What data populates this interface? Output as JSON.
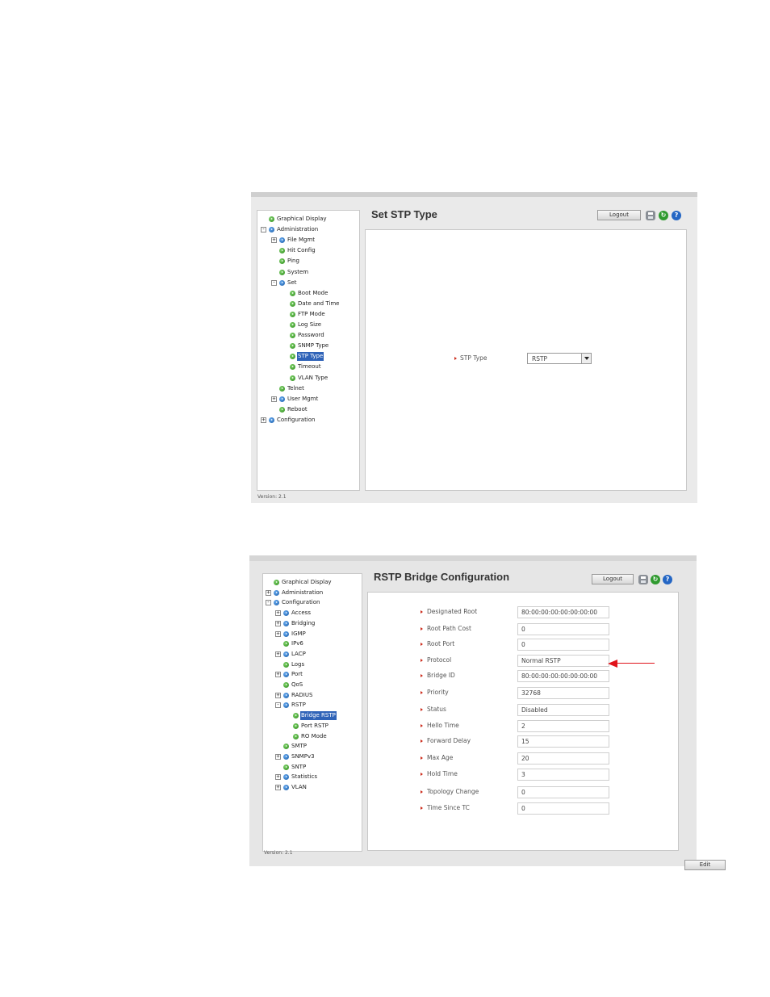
{
  "screen1": {
    "title": "Set STP Type",
    "logout_label": "Logout",
    "save_icon": "save-icon",
    "refresh_icon": "refresh-icon",
    "help_icon": "help-icon",
    "help_glyph": "?",
    "refresh_glyph": "↻",
    "version": "Version: 2.1",
    "nav": [
      {
        "label": "Graphical Display",
        "level": 0,
        "toggle": "",
        "dot": "green"
      },
      {
        "label": "Administration",
        "level": 0,
        "toggle": "−",
        "dot": "blue"
      },
      {
        "label": "File Mgmt",
        "level": 1,
        "toggle": "+",
        "dot": "blue"
      },
      {
        "label": "Hit Config",
        "level": 1,
        "toggle": "",
        "dot": "green"
      },
      {
        "label": "Ping",
        "level": 1,
        "toggle": "",
        "dot": "green"
      },
      {
        "label": "System",
        "level": 1,
        "toggle": "",
        "dot": "green"
      },
      {
        "label": "Set",
        "level": 1,
        "toggle": "−",
        "dot": "blue"
      },
      {
        "label": "Boot Mode",
        "level": 2,
        "toggle": "",
        "dot": "green"
      },
      {
        "label": "Date and Time",
        "level": 2,
        "toggle": "",
        "dot": "green"
      },
      {
        "label": "FTP Mode",
        "level": 2,
        "toggle": "",
        "dot": "green"
      },
      {
        "label": "Log Size",
        "level": 2,
        "toggle": "",
        "dot": "green"
      },
      {
        "label": "Password",
        "level": 2,
        "toggle": "",
        "dot": "green"
      },
      {
        "label": "SNMP Type",
        "level": 2,
        "toggle": "",
        "dot": "green"
      },
      {
        "label": "STP Type",
        "level": 2,
        "toggle": "",
        "dot": "green",
        "selected": true
      },
      {
        "label": "Timeout",
        "level": 2,
        "toggle": "",
        "dot": "green"
      },
      {
        "label": "VLAN Type",
        "level": 2,
        "toggle": "",
        "dot": "green"
      },
      {
        "label": "Telnet",
        "level": 1,
        "toggle": "",
        "dot": "green"
      },
      {
        "label": "User Mgmt",
        "level": 1,
        "toggle": "+",
        "dot": "blue"
      },
      {
        "label": "Reboot",
        "level": 1,
        "toggle": "",
        "dot": "green"
      },
      {
        "label": "Configuration",
        "level": 0,
        "toggle": "+",
        "dot": "blue"
      }
    ],
    "stp_type_label": "STP Type",
    "stp_type_value": "RSTP"
  },
  "screen2": {
    "title": "RSTP Bridge Configuration",
    "logout_label": "Logout",
    "help_glyph": "?",
    "refresh_glyph": "↻",
    "version": "Version: 2.1",
    "nav": [
      {
        "label": "Graphical Display",
        "level": 0,
        "toggle": "",
        "dot": "green"
      },
      {
        "label": "Administration",
        "level": 0,
        "toggle": "+",
        "dot": "blue"
      },
      {
        "label": "Configuration",
        "level": 0,
        "toggle": "−",
        "dot": "blue"
      },
      {
        "label": "Access",
        "level": 1,
        "toggle": "+",
        "dot": "blue"
      },
      {
        "label": "Bridging",
        "level": 1,
        "toggle": "+",
        "dot": "blue"
      },
      {
        "label": "IGMP",
        "level": 1,
        "toggle": "+",
        "dot": "blue"
      },
      {
        "label": "IPv6",
        "level": 1,
        "toggle": "",
        "dot": "green"
      },
      {
        "label": "LACP",
        "level": 1,
        "toggle": "+",
        "dot": "blue"
      },
      {
        "label": "Logs",
        "level": 1,
        "toggle": "",
        "dot": "green"
      },
      {
        "label": "Port",
        "level": 1,
        "toggle": "+",
        "dot": "blue"
      },
      {
        "label": "QoS",
        "level": 1,
        "toggle": "",
        "dot": "green"
      },
      {
        "label": "RADIUS",
        "level": 1,
        "toggle": "+",
        "dot": "blue"
      },
      {
        "label": "RSTP",
        "level": 1,
        "toggle": "−",
        "dot": "blue"
      },
      {
        "label": "Bridge RSTP",
        "level": 2,
        "toggle": "",
        "dot": "green",
        "selected": true
      },
      {
        "label": "Port RSTP",
        "level": 2,
        "toggle": "",
        "dot": "green"
      },
      {
        "label": "RO Mode",
        "level": 2,
        "toggle": "",
        "dot": "green"
      },
      {
        "label": "SMTP",
        "level": 1,
        "toggle": "",
        "dot": "green"
      },
      {
        "label": "SNMPv3",
        "level": 1,
        "toggle": "+",
        "dot": "blue"
      },
      {
        "label": "SNTP",
        "level": 1,
        "toggle": "",
        "dot": "green"
      },
      {
        "label": "Statistics",
        "level": 1,
        "toggle": "+",
        "dot": "blue"
      },
      {
        "label": "VLAN",
        "level": 1,
        "toggle": "+",
        "dot": "blue"
      }
    ],
    "fields": [
      {
        "label": "Designated Root",
        "value": "80:00:00:00:00:00:00:00"
      },
      {
        "label": "Root Path Cost",
        "value": "0"
      },
      {
        "label": "Root Port",
        "value": "0"
      },
      {
        "label": "Protocol",
        "value": "Normal RSTP"
      },
      {
        "label": "Bridge ID",
        "value": "80:00:00:00:00:00:00:00"
      },
      {
        "label": "Priority",
        "value": "32768"
      },
      {
        "label": "Status",
        "value": "Disabled"
      },
      {
        "label": "Hello Time",
        "value": "2"
      },
      {
        "label": "Forward Delay",
        "value": "15"
      },
      {
        "label": "Max Age",
        "value": "20"
      },
      {
        "label": "Hold Time",
        "value": "3"
      },
      {
        "label": "Topology Change",
        "value": "0"
      },
      {
        "label": "Time Since TC",
        "value": "0"
      }
    ],
    "edit_label": "Edit",
    "annotation_color": "#e0141b"
  }
}
